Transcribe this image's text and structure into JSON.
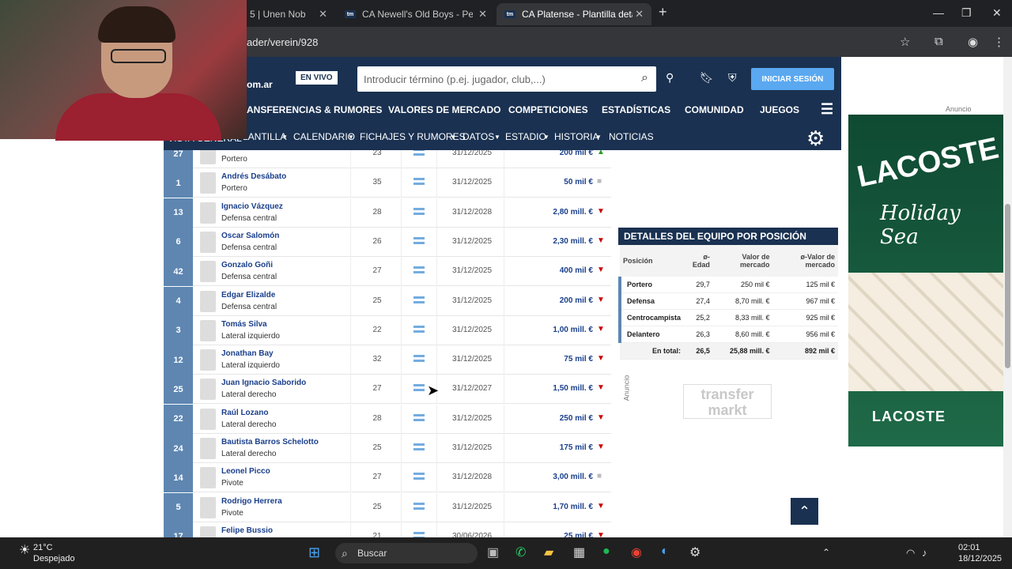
{
  "browser": {
    "tabs": [
      {
        "label": "5 | Unen Nob"
      },
      {
        "label": "CA Newell's Old Boys - Perfil de"
      },
      {
        "label": "CA Platense - Plantilla detallada"
      }
    ],
    "url": "ader/verein/928"
  },
  "site": {
    "logo": "om.ar",
    "live_badge": "EN VIVO",
    "search_placeholder": "Introducir término (p.ej. jugador, club,...)",
    "login": "INICIAR SESIÓN",
    "nav_main": [
      "ANSFERENCIAS & RUMORES",
      "VALORES DE MERCADO",
      "COMPETICIONES",
      "ESTADÍSTICAS",
      "COMUNIDAD",
      "JUEGOS"
    ],
    "nav_sub": [
      "VISTA GENERAL",
      "PLANTILLA",
      "CALENDARIO",
      "FICHAJES Y RUMORES",
      "DATOS",
      "ESTADIO",
      "HISTORIA",
      "NOTICIAS"
    ]
  },
  "players": [
    {
      "num": "27",
      "name": "",
      "pos": "Portero",
      "age": "23",
      "date": "31/12/2025",
      "value": "200 mil €",
      "trend": "up"
    },
    {
      "num": "1",
      "name": "Andrés Desábato",
      "pos": "Portero",
      "age": "35",
      "date": "31/12/2025",
      "value": "50 mil €",
      "trend": "flat"
    },
    {
      "num": "13",
      "name": "Ignacio Vázquez",
      "pos": "Defensa central",
      "age": "28",
      "date": "31/12/2028",
      "value": "2,80 mill. €",
      "trend": "down"
    },
    {
      "num": "6",
      "name": "Oscar Salomón",
      "pos": "Defensa central",
      "age": "26",
      "date": "31/12/2025",
      "value": "2,30 mill. €",
      "trend": "down"
    },
    {
      "num": "42",
      "name": "Gonzalo Goñi",
      "pos": "Defensa central",
      "age": "27",
      "date": "31/12/2025",
      "value": "400 mil €",
      "trend": "down"
    },
    {
      "num": "4",
      "name": "Edgar Elizalde",
      "pos": "Defensa central",
      "age": "25",
      "date": "31/12/2025",
      "value": "200 mil €",
      "trend": "down"
    },
    {
      "num": "3",
      "name": "Tomás Silva",
      "pos": "Lateral izquierdo",
      "age": "22",
      "date": "31/12/2025",
      "value": "1,00 mill. €",
      "trend": "down"
    },
    {
      "num": "12",
      "name": "Jonathan Bay",
      "pos": "Lateral izquierdo",
      "age": "32",
      "date": "31/12/2025",
      "value": "75 mil €",
      "trend": "down"
    },
    {
      "num": "25",
      "name": "Juan Ignacio Saborido",
      "pos": "Lateral derecho",
      "age": "27",
      "date": "31/12/2027",
      "value": "1,50 mill. €",
      "trend": "down"
    },
    {
      "num": "22",
      "name": "Raúl Lozano",
      "pos": "Lateral derecho",
      "age": "28",
      "date": "31/12/2025",
      "value": "250 mil €",
      "trend": "down"
    },
    {
      "num": "24",
      "name": "Bautista Barros Schelotto",
      "pos": "Lateral derecho",
      "age": "25",
      "date": "31/12/2025",
      "value": "175 mil €",
      "trend": "down"
    },
    {
      "num": "14",
      "name": "Leonel Picco",
      "pos": "Pivote",
      "age": "27",
      "date": "31/12/2028",
      "value": "3,00 mill. €",
      "trend": "flat"
    },
    {
      "num": "5",
      "name": "Rodrigo Herrera",
      "pos": "Pivote",
      "age": "25",
      "date": "31/12/2025",
      "value": "1,70 mill. €",
      "trend": "down"
    },
    {
      "num": "17",
      "name": "Felipe Bussio",
      "pos": "",
      "age": "21",
      "date": "30/06/2026",
      "value": "25 mil €",
      "trend": "down"
    }
  ],
  "sidebar": {
    "title": "DETALLES DEL EQUIPO POR POSICIÓN",
    "headers": [
      "Posición",
      "ø-Edad",
      "Valor de mercado",
      "ø-Valor de mercado"
    ],
    "rows": [
      [
        "Portero",
        "29,7",
        "250 mil €",
        "125 mil €"
      ],
      [
        "Defensa",
        "27,4",
        "8,70 mill. €",
        "967 mil €"
      ],
      [
        "Centrocampista",
        "25,2",
        "8,33 mill. €",
        "925 mil €"
      ],
      [
        "Delantero",
        "26,3",
        "8,60 mill. €",
        "956 mil €"
      ]
    ],
    "total": [
      "En total:",
      "26,5",
      "25,88 mill. €",
      "892 mil €"
    ]
  },
  "ads": {
    "label": "Anuncio",
    "brand": "LACOSTE",
    "tagline": "Holiday Sea"
  },
  "watermark": "transfer markt",
  "taskbar": {
    "temp": "21°C",
    "weather": "Despejado",
    "search": "Buscar",
    "time": "02:01",
    "date": "18/12/2025"
  }
}
